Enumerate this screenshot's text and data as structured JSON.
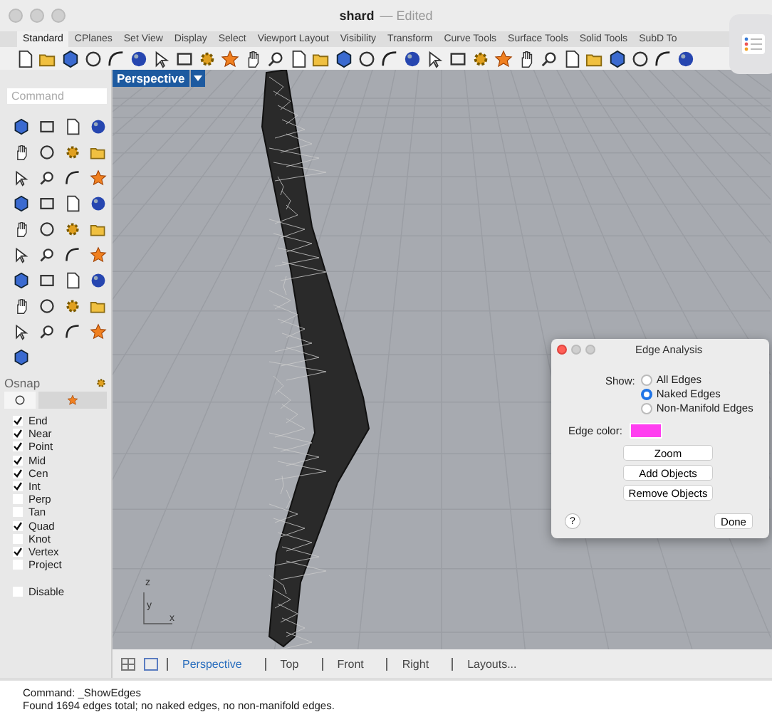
{
  "window": {
    "title": "shard",
    "status": "— Edited"
  },
  "tabs": [
    {
      "label": "Standard",
      "selected": true
    },
    {
      "label": "CPlanes",
      "selected": false
    },
    {
      "label": "Set View",
      "selected": false
    },
    {
      "label": "Display",
      "selected": false
    },
    {
      "label": "Select",
      "selected": false
    },
    {
      "label": "Viewport Layout",
      "selected": false
    },
    {
      "label": "Visibility",
      "selected": false
    },
    {
      "label": "Transform",
      "selected": false
    },
    {
      "label": "Curve Tools",
      "selected": false
    },
    {
      "label": "Surface Tools",
      "selected": false
    },
    {
      "label": "Solid Tools",
      "selected": false
    },
    {
      "label": "SubD To",
      "selected": false
    }
  ],
  "command_field": {
    "placeholder": "Command"
  },
  "viewport": {
    "label": "Perspective",
    "axes": {
      "z": "z",
      "y": "y",
      "x": "x"
    }
  },
  "osnap": {
    "title": "Osnap",
    "items": [
      {
        "label": "End",
        "checked": true
      },
      {
        "label": "Near",
        "checked": true
      },
      {
        "label": "Point",
        "checked": true
      },
      {
        "label": "Mid",
        "checked": true
      },
      {
        "label": "Cen",
        "checked": true
      },
      {
        "label": "Int",
        "checked": true
      },
      {
        "label": "Perp",
        "checked": false
      },
      {
        "label": "Tan",
        "checked": false
      },
      {
        "label": "Quad",
        "checked": true
      },
      {
        "label": "Knot",
        "checked": false
      },
      {
        "label": "Vertex",
        "checked": true
      },
      {
        "label": "Project",
        "checked": false
      }
    ],
    "disable": {
      "label": "Disable",
      "checked": false
    }
  },
  "viewport_tabs": [
    {
      "label": "Perspective",
      "selected": true
    },
    {
      "label": "Top",
      "selected": false
    },
    {
      "label": "Front",
      "selected": false
    },
    {
      "label": "Right",
      "selected": false
    },
    {
      "label": "Layouts...",
      "selected": false
    }
  ],
  "command_history": [
    "Command: _ShowEdges",
    "Found 1694 edges total; no naked edges, no non-manifold edges."
  ],
  "dialog": {
    "title": "Edge Analysis",
    "show_label": "Show:",
    "options": [
      {
        "label": "All Edges",
        "selected": false
      },
      {
        "label": "Naked Edges",
        "selected": true
      },
      {
        "label": "Non-Manifold Edges",
        "selected": false
      }
    ],
    "edge_color": {
      "label": "Edge color:",
      "color": "#ff3ef0"
    },
    "buttons": [
      "Zoom",
      "Add Objects",
      "Remove Objects"
    ],
    "help": "?",
    "done": "Done"
  }
}
